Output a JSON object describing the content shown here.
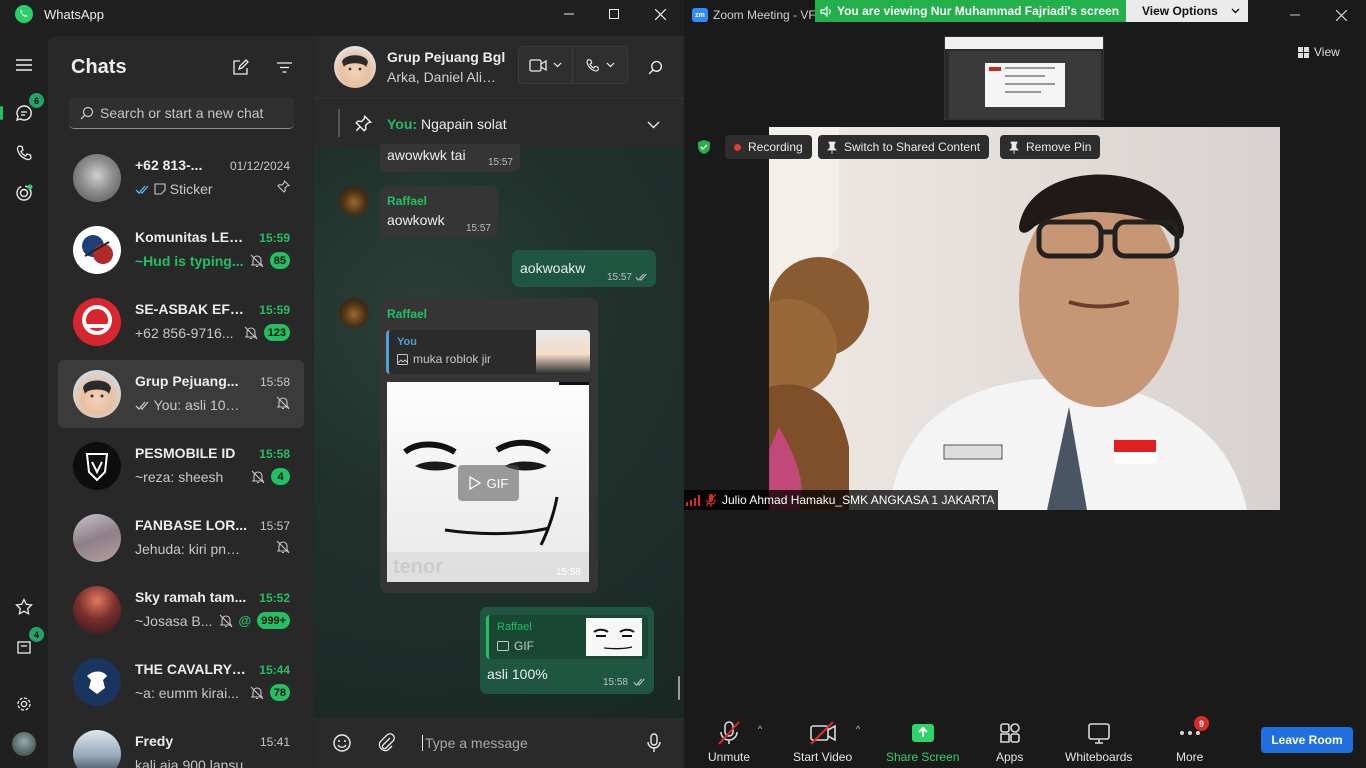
{
  "whatsapp": {
    "app_title": "WhatsApp",
    "rail": {
      "chats_badge": "6",
      "archived_badge": "4"
    },
    "chatlist": {
      "title": "Chats",
      "search_placeholder": "Search or start a new chat",
      "items": [
        {
          "name": "+62 813-...",
          "time": "01/12/2024",
          "preview": "Sticker",
          "unread": "",
          "time_green": false
        },
        {
          "name": "Komunitas LEO...",
          "time": "15:59",
          "preview": "~Hud is typing...",
          "unread": "85",
          "time_green": true
        },
        {
          "name": "SE-ASBAK EFO...",
          "time": "15:59",
          "preview": "+62 856-9716...",
          "unread": "123",
          "time_green": true
        },
        {
          "name": "Grup Pejuang...",
          "time": "15:58",
          "preview": "You: asli 100%",
          "unread": "",
          "time_green": false
        },
        {
          "name": "PESMOBILE ID",
          "time": "15:58",
          "preview": "~reza: sheesh",
          "unread": "4",
          "time_green": true
        },
        {
          "name": "FANBASE LOR...",
          "time": "15:57",
          "preview": "Jehuda: kiri pnya...",
          "unread": "",
          "time_green": false
        },
        {
          "name": "Sky ramah tam...",
          "time": "15:52",
          "preview": "~Josasa B...",
          "unread": "999+",
          "mention": "@",
          "time_green": true
        },
        {
          "name": "THE CAVALRY ID",
          "time": "15:44",
          "preview": "~a: eumm kirai...",
          "unread": "78",
          "time_green": true
        },
        {
          "name": "Fredy",
          "time": "15:41",
          "preview": "kali aja 900 lansu",
          "unread": "",
          "time_green": false
        }
      ]
    },
    "conversation": {
      "group_name": "Grup Pejuang Bgl",
      "members": "Arka, Daniel Ali,...",
      "pinned_prefix": "You:",
      "pinned_text": "Ngapain solat",
      "messages": [
        {
          "text": "awowkwk tai",
          "time": "15:57"
        },
        {
          "sender": "Raffael",
          "text": "aowkowk",
          "time": "15:57"
        },
        {
          "text": "aokwoakw",
          "time": "15:57"
        },
        {
          "sender": "Raffael",
          "quote_author": "You",
          "quote_text": "muka roblok jir",
          "gif_label": "GIF",
          "gif_watermark": "tenor",
          "time": "15:58"
        },
        {
          "quote_author": "Raffael",
          "quote_text": "GIF",
          "text": "asli 100%",
          "time": "15:58"
        }
      ],
      "composer_placeholder": "Type a message"
    }
  },
  "zoom": {
    "window_title": "Zoom Meeting - VF",
    "logo_text": "zm",
    "banner_text": "You are viewing Nur Muhammad Fajriadi's screen",
    "view_options": "View Options",
    "view_button": "View",
    "recording": "Recording",
    "switch_shared": "Switch to Shared Content",
    "remove_pin": "Remove Pin",
    "participant_name": "Julio Ahmad Hamaku_SMK ANGKASA 1 JAKARTA",
    "toolbar": {
      "unmute": "Unmute",
      "start_video": "Start Video",
      "share_screen": "Share Screen",
      "apps": "Apps",
      "whiteboards": "Whiteboards",
      "more": "More",
      "more_badge": "9",
      "leave": "Leave Room"
    },
    "colors": {
      "banner": "#22b04b",
      "leave": "#1f6fe0",
      "share": "#2cd46b"
    }
  }
}
